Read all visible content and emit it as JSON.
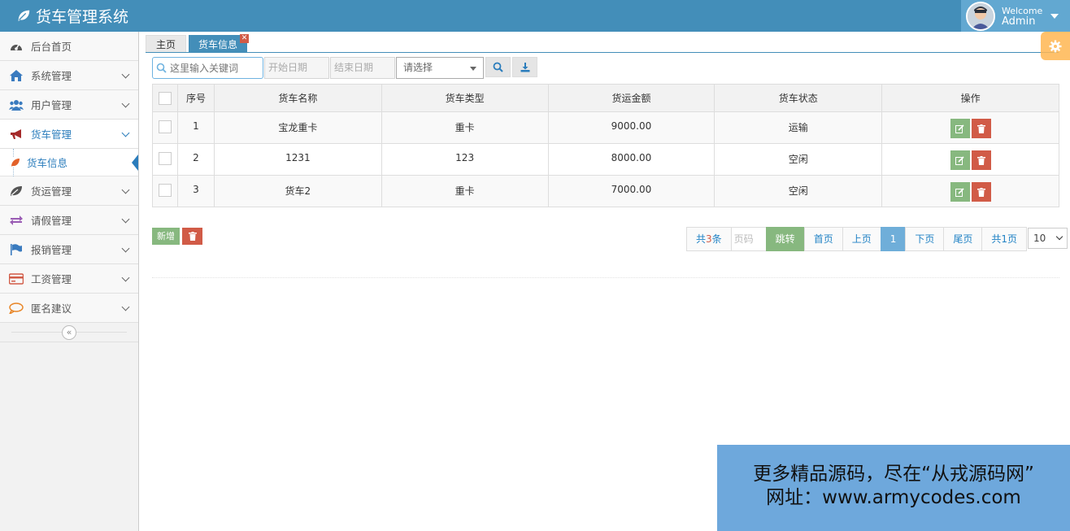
{
  "app": {
    "title": "货车管理系统"
  },
  "user": {
    "welcome": "Welcome",
    "name": "Admin"
  },
  "sidebar": {
    "items": [
      {
        "label": "后台首页",
        "icon": "dashboard-icon"
      },
      {
        "label": "系统管理",
        "icon": "home-icon"
      },
      {
        "label": "用户管理",
        "icon": "users-icon"
      },
      {
        "label": "货车管理",
        "icon": "bullhorn-icon"
      },
      {
        "label": "货运管理",
        "icon": "leaf-icon"
      },
      {
        "label": "请假管理",
        "icon": "exchange-icon"
      },
      {
        "label": "报销管理",
        "icon": "flag-icon"
      },
      {
        "label": "工资管理",
        "icon": "credit-card-icon"
      },
      {
        "label": "匿名建议",
        "icon": "comment-icon"
      }
    ],
    "sub_item": {
      "label": "货车信息",
      "icon": "leaf-icon"
    },
    "collapse_glyph": "«"
  },
  "tabs": [
    {
      "label": "主页"
    },
    {
      "label": "货车信息"
    }
  ],
  "toolbar": {
    "search_placeholder": "这里输入关键词",
    "start_date_placeholder": "开始日期",
    "end_date_placeholder": "结束日期",
    "select_value": "请选择"
  },
  "table": {
    "headers": [
      "序号",
      "货车名称",
      "货车类型",
      "货运金额",
      "货车状态",
      "操作"
    ],
    "rows": [
      {
        "no": "1",
        "name": "宝龙重卡",
        "type": "重卡",
        "amount": "9000.00",
        "status": "运输"
      },
      {
        "no": "2",
        "name": "1231",
        "type": "123",
        "amount": "8000.00",
        "status": "空闲"
      },
      {
        "no": "3",
        "name": "货车2",
        "type": "重卡",
        "amount": "7000.00",
        "status": "空闲"
      }
    ]
  },
  "actions": {
    "add_label": "新增"
  },
  "pager": {
    "total_prefix": "共",
    "total_count": "3",
    "total_suffix": "条",
    "page_input_placeholder": "页码",
    "go_label": "跳转",
    "first_label": "首页",
    "prev_label": "上页",
    "current_page": "1",
    "next_label": "下页",
    "last_label": "尾页",
    "pages_label": "共1页",
    "page_size": "10"
  },
  "watermark": {
    "line1": "更多精品源码，尽在“从戎源码网”",
    "line2": "网址：www.armycodes.com"
  },
  "colors": {
    "navbar": "#438eb9",
    "accent": "#2b7dbc",
    "edit_button": "#87b87f",
    "delete_button": "#d15b47",
    "gear": "#ffb752",
    "watermark_bg": "#6ea8dc"
  }
}
